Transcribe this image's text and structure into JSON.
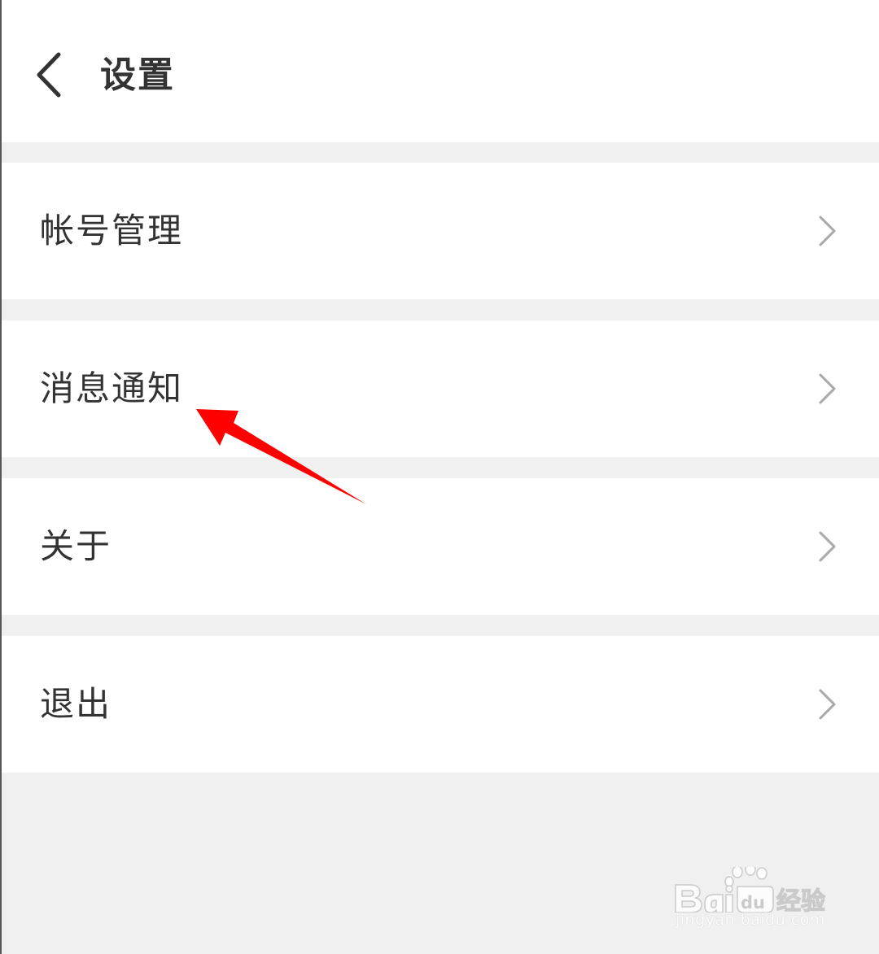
{
  "header": {
    "back_icon": "chevron-left-icon",
    "title": "设置"
  },
  "settings": {
    "items": [
      {
        "label": "帐号管理",
        "icon": "chevron-right-icon"
      },
      {
        "label": "消息通知",
        "icon": "chevron-right-icon"
      },
      {
        "label": "关于",
        "icon": "chevron-right-icon"
      },
      {
        "label": "退出",
        "icon": "chevron-right-icon"
      }
    ]
  },
  "annotation": {
    "type": "arrow",
    "color": "#ff0000",
    "points_to": "消息通知"
  },
  "watermark": {
    "logo_text": "Bai du 经验",
    "url": "jingyan.baidu.com"
  },
  "colors": {
    "background": "#f0f0f0",
    "surface": "#ffffff",
    "text": "#333333",
    "chevron": "#a8a8a8"
  }
}
